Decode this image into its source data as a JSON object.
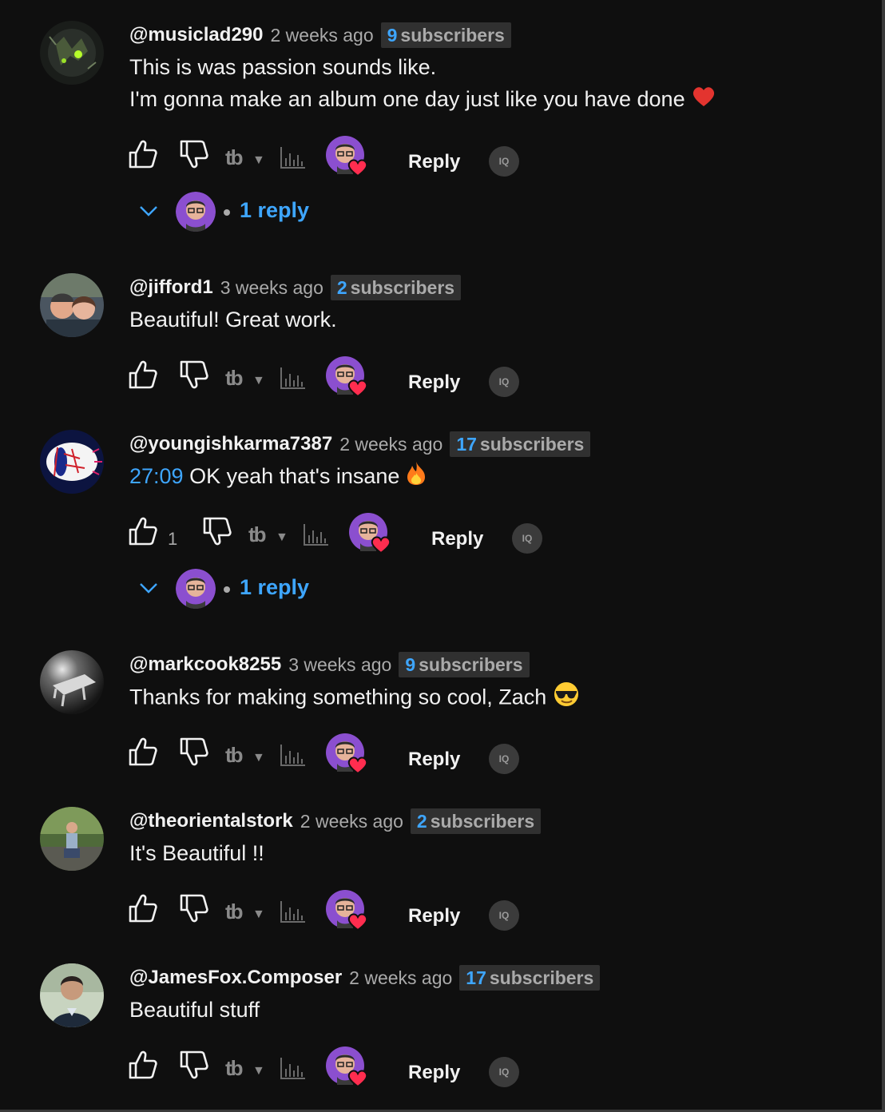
{
  "labels": {
    "reply": "Reply",
    "tb_logo": "tb",
    "iq_badge": "IQ"
  },
  "colors": {
    "background": "#0f0f0f",
    "link_blue": "#3ea6ff",
    "heart_red": "#ff2d4f",
    "avatar_purple": "#8b4fcf"
  },
  "comments": [
    {
      "author": "@musiclad290",
      "time": "2 weeks ago",
      "subscribers_count": "9",
      "subscribers_label": "subscribers",
      "line1": "This is was passion sounds like.",
      "line2": "I'm gonna make an album one day just like you have done",
      "emoji": "red-heart",
      "like_count": "",
      "replies_text": "1 reply"
    },
    {
      "author": "@jifford1",
      "time": "3 weeks ago",
      "subscribers_count": "2",
      "subscribers_label": "subscribers",
      "line1": "Beautiful! Great work.",
      "like_count": ""
    },
    {
      "author": "@youngishkarma7387",
      "time": "2 weeks ago",
      "subscribers_count": "17",
      "subscribers_label": "subscribers",
      "timestamp": "27:09",
      "line1": "OK yeah that's insane",
      "emoji": "fire",
      "like_count": "1",
      "replies_text": "1 reply"
    },
    {
      "author": "@markcook8255",
      "time": "3 weeks ago",
      "subscribers_count": "9",
      "subscribers_label": "subscribers",
      "line1": "Thanks for making something so cool, Zach",
      "emoji": "sunglasses",
      "like_count": ""
    },
    {
      "author": "@theorientalstork",
      "time": "2 weeks ago",
      "subscribers_count": "2",
      "subscribers_label": "subscribers",
      "line1": "It's Beautiful !!",
      "like_count": ""
    },
    {
      "author": "@JamesFox.Composer",
      "time": "2 weeks ago",
      "subscribers_count": "17",
      "subscribers_label": "subscribers",
      "line1": "Beautiful stuff",
      "like_count": ""
    }
  ]
}
